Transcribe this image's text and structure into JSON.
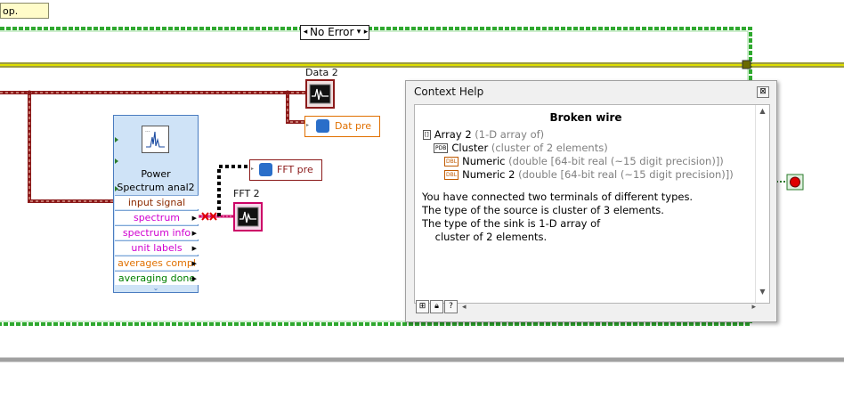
{
  "note": {
    "text": "op."
  },
  "case_selector": {
    "value": "No Error"
  },
  "labels": {
    "data2": "Data 2",
    "fft2": "FFT 2"
  },
  "express_vi": {
    "title_line1": "Power",
    "title_line2": "Spectrum anal2",
    "terminals": [
      {
        "label": "input signal",
        "color": "#8b2a00",
        "arrow": false
      },
      {
        "label": "spectrum",
        "color": "#d000d0",
        "arrow": true
      },
      {
        "label": "spectrum info",
        "color": "#d000d0",
        "arrow": true
      },
      {
        "label": "unit labels",
        "color": "#d000d0",
        "arrow": true
      },
      {
        "label": "averages compl",
        "color": "#e07000",
        "arrow": true
      },
      {
        "label": "averaging done",
        "color": "#008000",
        "arrow": true
      }
    ]
  },
  "property_nodes": {
    "dat": "Dat pre",
    "fft": "FFT pre"
  },
  "context_help": {
    "window_title": "Context Help",
    "heading": "Broken wire",
    "tree": [
      {
        "name": "Array 2",
        "type": "(1-D array of)",
        "tag": "[]",
        "level": 0
      },
      {
        "name": "Cluster",
        "type": "(cluster of 2 elements)",
        "tag": "PDB",
        "level": 1
      },
      {
        "name": "Numeric",
        "type": "(double [64-bit real (~15 digit precision)])",
        "tag": "DBL",
        "level": 2
      },
      {
        "name": "Numeric 2",
        "type": "(double [64-bit real (~15 digit precision)])",
        "tag": "DBL",
        "level": 2
      }
    ],
    "description": [
      "You have connected two terminals of different types.",
      "The type of the source is cluster of 3 elements.",
      "The type of the sink is 1-D array of",
      "    cluster of 2 elements."
    ]
  },
  "colors": {
    "case_border": "#2fa82f",
    "wire_error": "#8b1a1a",
    "wire_pink": "#cc0066",
    "broken_wire": "#000000"
  },
  "icons": {
    "close": "close-icon",
    "lock": "lock-icon",
    "help": "help-icon",
    "window": "window-icon",
    "run_stop": "stop-indicator-icon"
  }
}
